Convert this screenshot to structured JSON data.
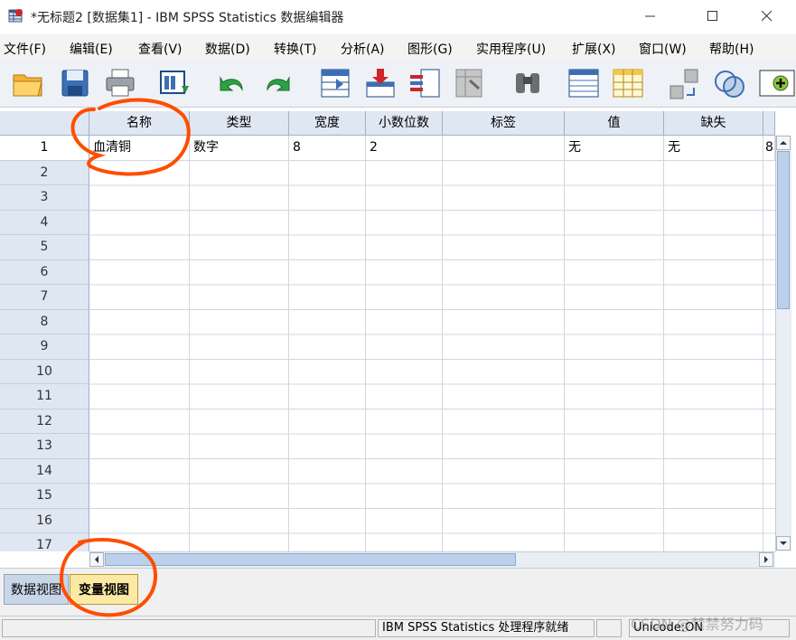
{
  "window": {
    "title": "*无标题2 [数据集1] - IBM SPSS Statistics 数据编辑器"
  },
  "menu": [
    "文件(F)",
    "编辑(E)",
    "查看(V)",
    "数据(D)",
    "转换(T)",
    "分析(A)",
    "图形(G)",
    "实用程序(U)",
    "扩展(X)",
    "窗口(W)",
    "帮助(H)"
  ],
  "toolbar": {
    "icons": [
      "open-folder-icon",
      "save-icon",
      "print-icon",
      "dialog-recall-icon",
      "undo-icon",
      "redo-icon",
      "goto-case-icon",
      "goto-variable-icon",
      "variables-icon",
      "run-descriptives-icon",
      "find-icon",
      "insert-cases-icon",
      "insert-variable-icon",
      "split-file-icon",
      "weight-cases-icon",
      "select-cases-icon",
      "value-labels-icon",
      "use-sets-icon"
    ]
  },
  "grid": {
    "columns": [
      "名称",
      "类型",
      "宽度",
      "小数位数",
      "标签",
      "值",
      "缺失",
      ""
    ],
    "rows": [
      [
        "血清铜",
        "数字",
        "8",
        "2",
        "",
        "无",
        "无",
        "8"
      ]
    ],
    "row_numbers": [
      "1",
      "2",
      "3",
      "4",
      "5",
      "6",
      "7",
      "8",
      "9",
      "10",
      "11",
      "12",
      "13",
      "14",
      "15",
      "16",
      "17"
    ],
    "active_row": "1"
  },
  "tabs": {
    "data_view": "数据视图",
    "variable_view": "变量视图",
    "active": "变量视图"
  },
  "status": {
    "processor": "IBM SPSS Statistics 处理程序就绪",
    "unicode": "Unicode:ON"
  },
  "watermark": "CSDN @禁禁努力码",
  "colors": {
    "annotation": "#ff4d00",
    "active_tab": "#fde9a6",
    "header_bg": "#dfe7f2"
  }
}
